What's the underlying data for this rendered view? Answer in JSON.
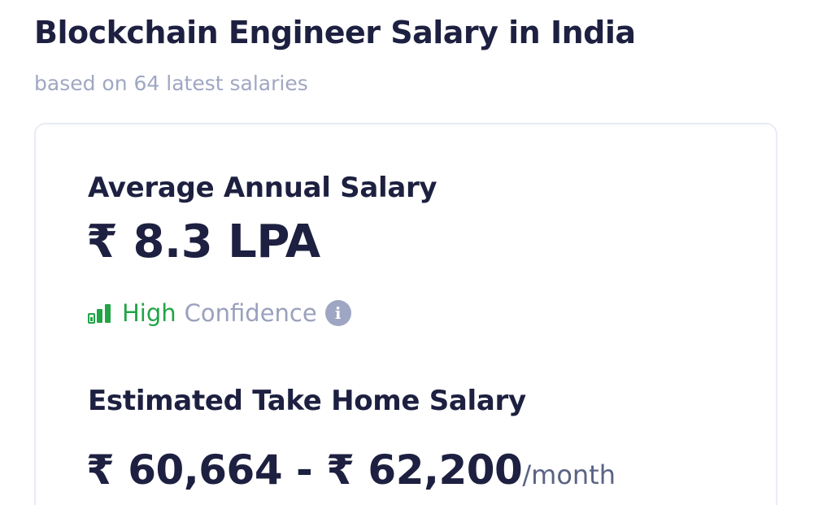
{
  "header": {
    "title": "Blockchain Engineer Salary in India",
    "subtitle": "based on 64 latest salaries"
  },
  "card": {
    "average": {
      "label": "Average Annual Salary",
      "value": "₹ 8.3 LPA"
    },
    "confidence": {
      "icon": "bar-chart-icon",
      "level": "High",
      "word": "Confidence",
      "info_icon": "info-icon",
      "info_glyph": "i",
      "level_color": "#22a447"
    },
    "take_home": {
      "label": "Estimated Take Home Salary",
      "range": "₹ 60,664 - ₹ 62,200",
      "unit": "/month"
    }
  },
  "colors": {
    "heading": "#1d2040",
    "muted": "#a0a7c2",
    "accent_green": "#22a447",
    "card_border": "#e8ecf3"
  }
}
